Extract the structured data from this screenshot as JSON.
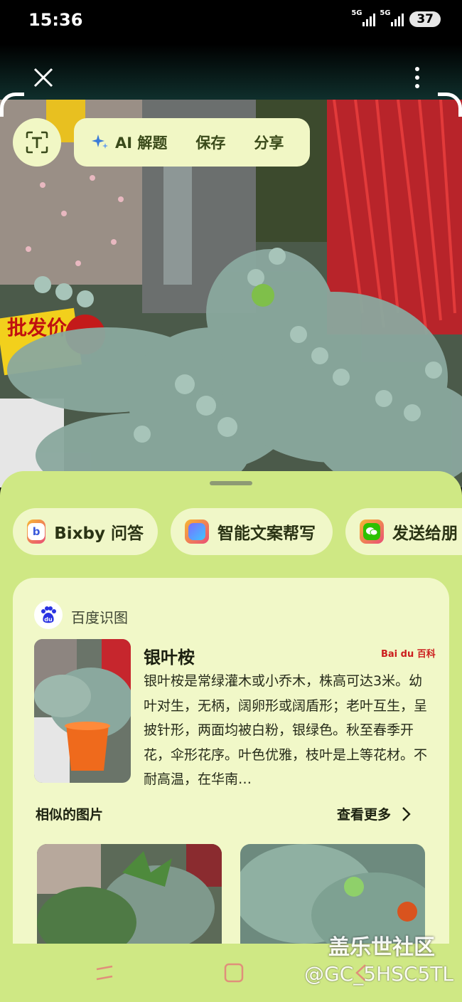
{
  "status": {
    "time": "15:36",
    "net1": "5G",
    "net2": "5G",
    "battery": "37"
  },
  "toolbar": {
    "ai_label": "AI 解题",
    "save_label": "保存",
    "share_label": "分享"
  },
  "photo_sign": "批发价",
  "chips": [
    {
      "label": "Bixby 问答",
      "icon": "bixby-icon"
    },
    {
      "label": "智能文案帮写",
      "icon": "writing-icon"
    },
    {
      "label": "发送给朋",
      "icon": "wechat-icon"
    }
  ],
  "card": {
    "source": "百度识图",
    "title": "银叶桉",
    "baike_logo": "Bai du 百科",
    "description": "银叶桉是常绿灌木或小乔木，株高可达3米。幼叶对生，无柄，阔卵形或阔盾形；老叶互生，呈披针形，两面均被白粉，银绿色。秋至春季开花，伞形花序。叶色优雅，枝叶是上等花材。不耐高温，在华南…",
    "similar_label": "相似的图片",
    "more_label": "查看更多"
  },
  "watermark": {
    "line1": "盖乐世社区",
    "line2": "@GC_5HSC5TL"
  },
  "colors": {
    "sheet": "#cfe884",
    "card": "#f1f8c8",
    "pill": "#f1f7c5",
    "accent_red": "#cc1d1d"
  }
}
